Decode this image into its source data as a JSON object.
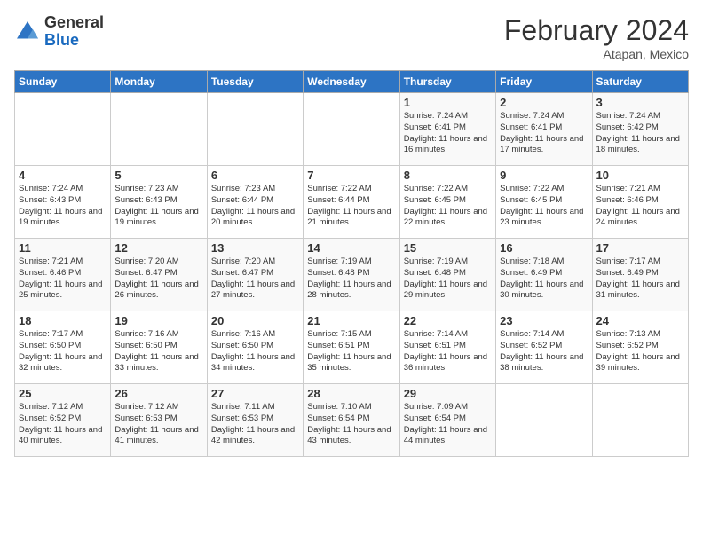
{
  "header": {
    "logo_general": "General",
    "logo_blue": "Blue",
    "month_year": "February 2024",
    "location": "Atapan, Mexico"
  },
  "days_of_week": [
    "Sunday",
    "Monday",
    "Tuesday",
    "Wednesday",
    "Thursday",
    "Friday",
    "Saturday"
  ],
  "weeks": [
    [
      {
        "day": "",
        "info": ""
      },
      {
        "day": "",
        "info": ""
      },
      {
        "day": "",
        "info": ""
      },
      {
        "day": "",
        "info": ""
      },
      {
        "day": "1",
        "info": "Sunrise: 7:24 AM\nSunset: 6:41 PM\nDaylight: 11 hours and 16 minutes."
      },
      {
        "day": "2",
        "info": "Sunrise: 7:24 AM\nSunset: 6:41 PM\nDaylight: 11 hours and 17 minutes."
      },
      {
        "day": "3",
        "info": "Sunrise: 7:24 AM\nSunset: 6:42 PM\nDaylight: 11 hours and 18 minutes."
      }
    ],
    [
      {
        "day": "4",
        "info": "Sunrise: 7:24 AM\nSunset: 6:43 PM\nDaylight: 11 hours and 19 minutes."
      },
      {
        "day": "5",
        "info": "Sunrise: 7:23 AM\nSunset: 6:43 PM\nDaylight: 11 hours and 19 minutes."
      },
      {
        "day": "6",
        "info": "Sunrise: 7:23 AM\nSunset: 6:44 PM\nDaylight: 11 hours and 20 minutes."
      },
      {
        "day": "7",
        "info": "Sunrise: 7:22 AM\nSunset: 6:44 PM\nDaylight: 11 hours and 21 minutes."
      },
      {
        "day": "8",
        "info": "Sunrise: 7:22 AM\nSunset: 6:45 PM\nDaylight: 11 hours and 22 minutes."
      },
      {
        "day": "9",
        "info": "Sunrise: 7:22 AM\nSunset: 6:45 PM\nDaylight: 11 hours and 23 minutes."
      },
      {
        "day": "10",
        "info": "Sunrise: 7:21 AM\nSunset: 6:46 PM\nDaylight: 11 hours and 24 minutes."
      }
    ],
    [
      {
        "day": "11",
        "info": "Sunrise: 7:21 AM\nSunset: 6:46 PM\nDaylight: 11 hours and 25 minutes."
      },
      {
        "day": "12",
        "info": "Sunrise: 7:20 AM\nSunset: 6:47 PM\nDaylight: 11 hours and 26 minutes."
      },
      {
        "day": "13",
        "info": "Sunrise: 7:20 AM\nSunset: 6:47 PM\nDaylight: 11 hours and 27 minutes."
      },
      {
        "day": "14",
        "info": "Sunrise: 7:19 AM\nSunset: 6:48 PM\nDaylight: 11 hours and 28 minutes."
      },
      {
        "day": "15",
        "info": "Sunrise: 7:19 AM\nSunset: 6:48 PM\nDaylight: 11 hours and 29 minutes."
      },
      {
        "day": "16",
        "info": "Sunrise: 7:18 AM\nSunset: 6:49 PM\nDaylight: 11 hours and 30 minutes."
      },
      {
        "day": "17",
        "info": "Sunrise: 7:17 AM\nSunset: 6:49 PM\nDaylight: 11 hours and 31 minutes."
      }
    ],
    [
      {
        "day": "18",
        "info": "Sunrise: 7:17 AM\nSunset: 6:50 PM\nDaylight: 11 hours and 32 minutes."
      },
      {
        "day": "19",
        "info": "Sunrise: 7:16 AM\nSunset: 6:50 PM\nDaylight: 11 hours and 33 minutes."
      },
      {
        "day": "20",
        "info": "Sunrise: 7:16 AM\nSunset: 6:50 PM\nDaylight: 11 hours and 34 minutes."
      },
      {
        "day": "21",
        "info": "Sunrise: 7:15 AM\nSunset: 6:51 PM\nDaylight: 11 hours and 35 minutes."
      },
      {
        "day": "22",
        "info": "Sunrise: 7:14 AM\nSunset: 6:51 PM\nDaylight: 11 hours and 36 minutes."
      },
      {
        "day": "23",
        "info": "Sunrise: 7:14 AM\nSunset: 6:52 PM\nDaylight: 11 hours and 38 minutes."
      },
      {
        "day": "24",
        "info": "Sunrise: 7:13 AM\nSunset: 6:52 PM\nDaylight: 11 hours and 39 minutes."
      }
    ],
    [
      {
        "day": "25",
        "info": "Sunrise: 7:12 AM\nSunset: 6:52 PM\nDaylight: 11 hours and 40 minutes."
      },
      {
        "day": "26",
        "info": "Sunrise: 7:12 AM\nSunset: 6:53 PM\nDaylight: 11 hours and 41 minutes."
      },
      {
        "day": "27",
        "info": "Sunrise: 7:11 AM\nSunset: 6:53 PM\nDaylight: 11 hours and 42 minutes."
      },
      {
        "day": "28",
        "info": "Sunrise: 7:10 AM\nSunset: 6:54 PM\nDaylight: 11 hours and 43 minutes."
      },
      {
        "day": "29",
        "info": "Sunrise: 7:09 AM\nSunset: 6:54 PM\nDaylight: 11 hours and 44 minutes."
      },
      {
        "day": "",
        "info": ""
      },
      {
        "day": "",
        "info": ""
      }
    ]
  ]
}
